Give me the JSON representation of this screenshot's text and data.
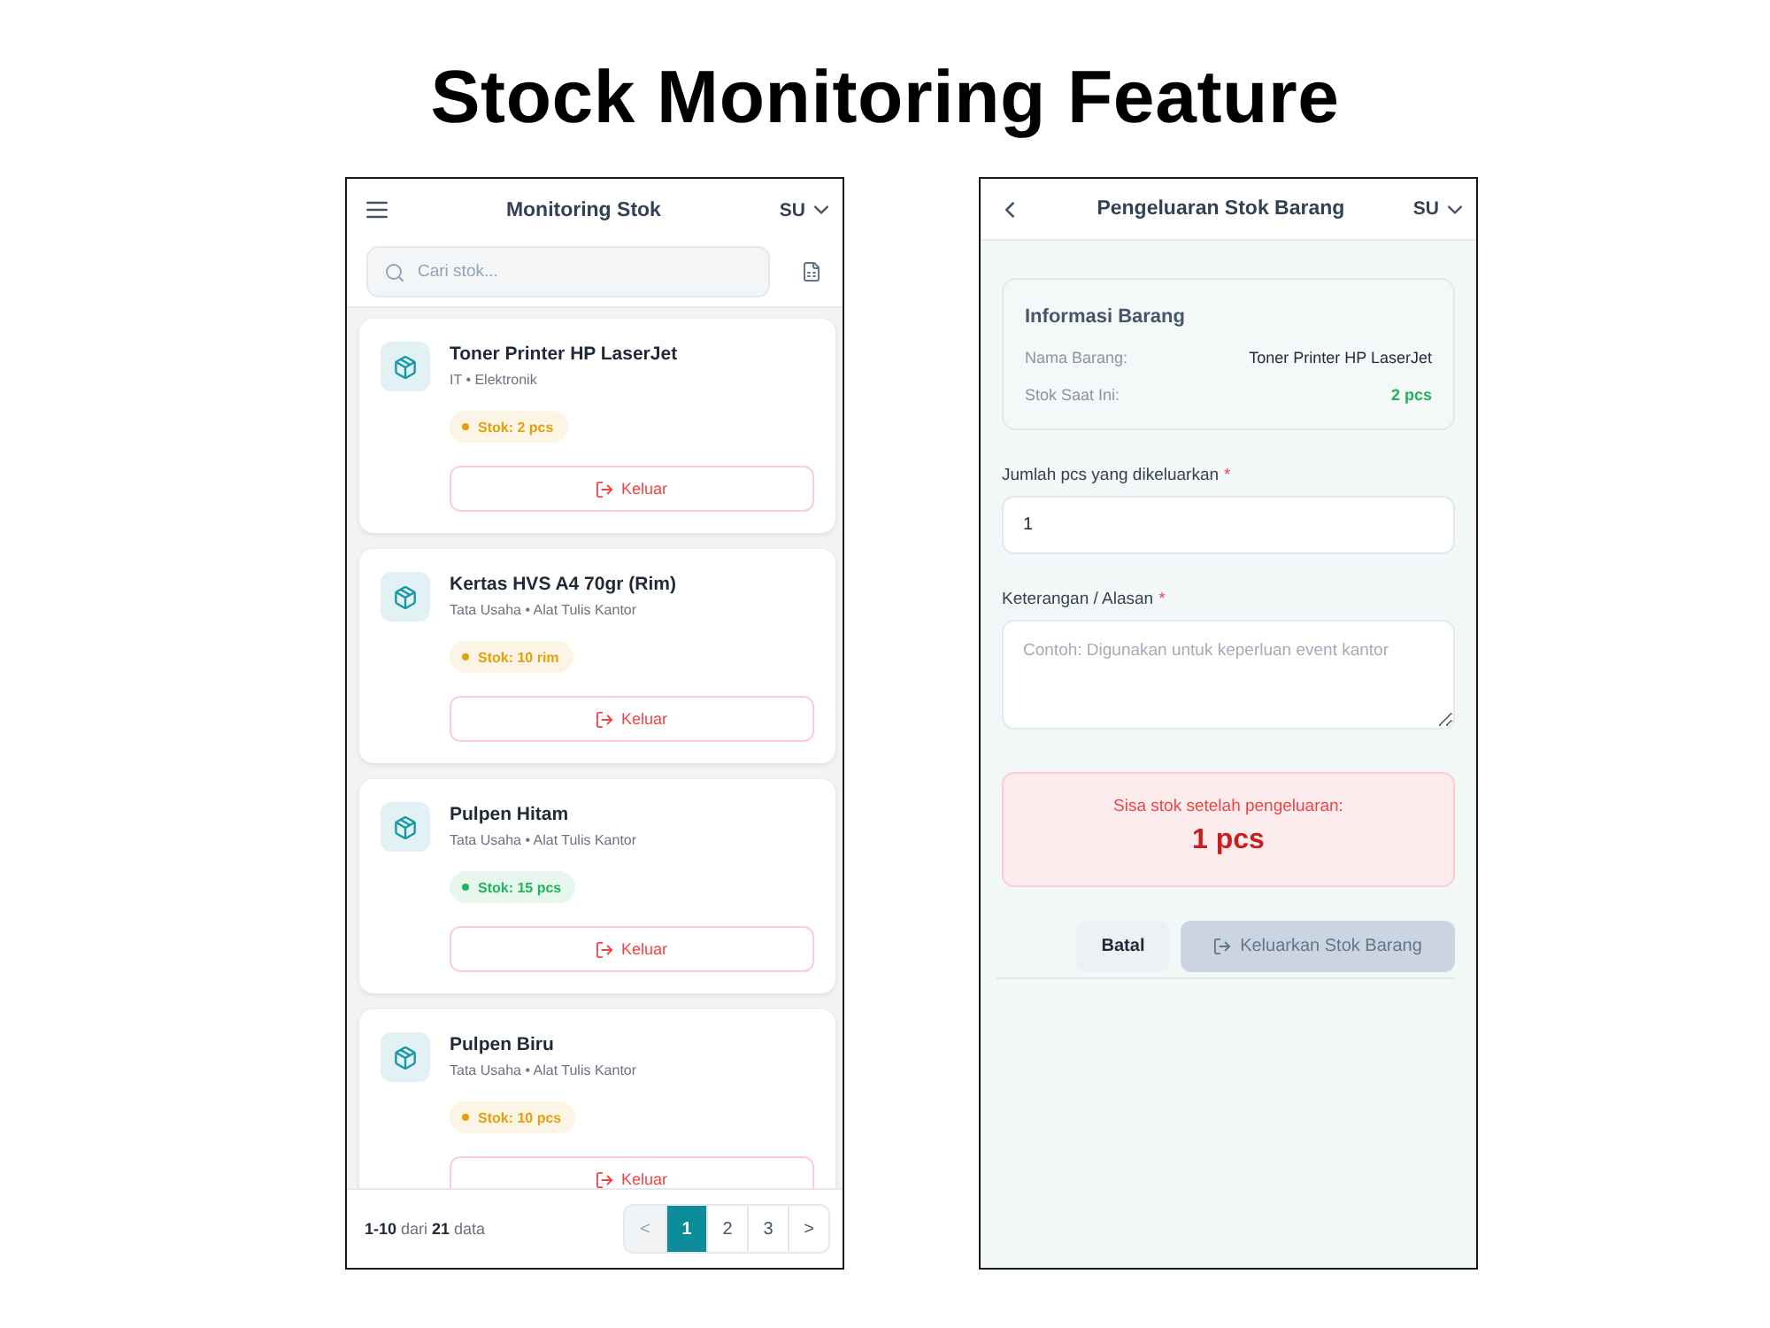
{
  "title": "Stock Monitoring Feature",
  "monitoring_screen": {
    "header": {
      "title": "Monitoring Stok",
      "user": "SU"
    },
    "search": {
      "placeholder": "Cari stok..."
    },
    "items": [
      {
        "name": "Toner Printer HP LaserJet",
        "category": "IT • Elektronik",
        "stock": "Stok: 2 pcs",
        "color": "#e0a20e",
        "action": "Keluar"
      },
      {
        "name": "Kertas HVS A4 70gr (Rim)",
        "category": "Tata Usaha • Alat Tulis Kantor",
        "stock": "Stok: 10 rim",
        "color": "#e0a20e",
        "action": "Keluar"
      },
      {
        "name": "Pulpen Hitam",
        "category": "Tata Usaha • Alat Tulis Kantor",
        "stock": "Stok: 15 pcs",
        "color": "#22b35e",
        "action": "Keluar"
      },
      {
        "name": "Pulpen Biru",
        "category": "Tata Usaha • Alat Tulis Kantor",
        "stock": "Stok: 10 pcs",
        "color": "#e0a20e",
        "action": "Keluar"
      }
    ],
    "pagination": {
      "summary": "**1-10** dari **21** data",
      "pages": [
        {
          "label": "<",
          "selected": false,
          "disabled": true
        },
        {
          "label": "1",
          "selected": true,
          "disabled": false
        },
        {
          "label": "2",
          "selected": false,
          "disabled": false
        },
        {
          "label": "3",
          "selected": false,
          "disabled": false
        },
        {
          "label": ">",
          "selected": false,
          "disabled": false
        }
      ]
    }
  },
  "issue_screen": {
    "header": {
      "title": "Pengeluaran Stok Barang",
      "user": "SU"
    },
    "info_card": {
      "title": "Informasi Barang",
      "rows": [
        {
          "label": "Nama Barang:",
          "value": "Toner Printer HP LaserJet",
          "kind": "text"
        },
        {
          "label": "Stok Saat Ini:",
          "value": "2 pcs",
          "kind": "stock"
        }
      ]
    },
    "fields": [
      {
        "kind": "input",
        "label": "Jumlah pcs yang dikeluarkan",
        "required_mark": "*",
        "value": "1"
      },
      {
        "kind": "textarea",
        "label": "Keterangan / Alasan",
        "required_mark": "*",
        "placeholder": "Contoh: Digunakan untuk keperluan event kantor"
      }
    ],
    "remaining": {
      "label": "Sisa stok setelah pengeluaran:",
      "value": "1 pcs"
    },
    "buttons": [
      {
        "kind": "cancel",
        "label": "Batal",
        "disabled": false
      },
      {
        "kind": "submit",
        "label": "Keluarkan Stok Barang",
        "disabled": true
      }
    ]
  }
}
